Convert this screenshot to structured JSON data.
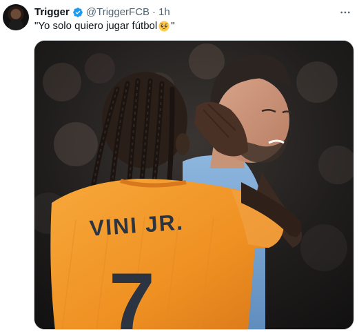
{
  "tweet": {
    "author_name": "Trigger",
    "author_handle": "@TriggerFCB",
    "separator": "·",
    "time": "1h",
    "text_before_emoji": "\"Yo solo quiero jugar fútbol",
    "emoji": "pleading-face",
    "text_after_emoji": "\"",
    "more_icon": "ellipsis-icon",
    "verified_icon": "verified-badge-icon",
    "media": {
      "jersey_name": "VINI JR.",
      "jersey_number": "7"
    }
  },
  "colors": {
    "verified_blue": "#1d9bf0",
    "jersey_orange": "#f39a2e",
    "jersey_lettering": "#2b3440",
    "opponent_kit": "#7fa9d6",
    "secondary_text": "#536471"
  }
}
